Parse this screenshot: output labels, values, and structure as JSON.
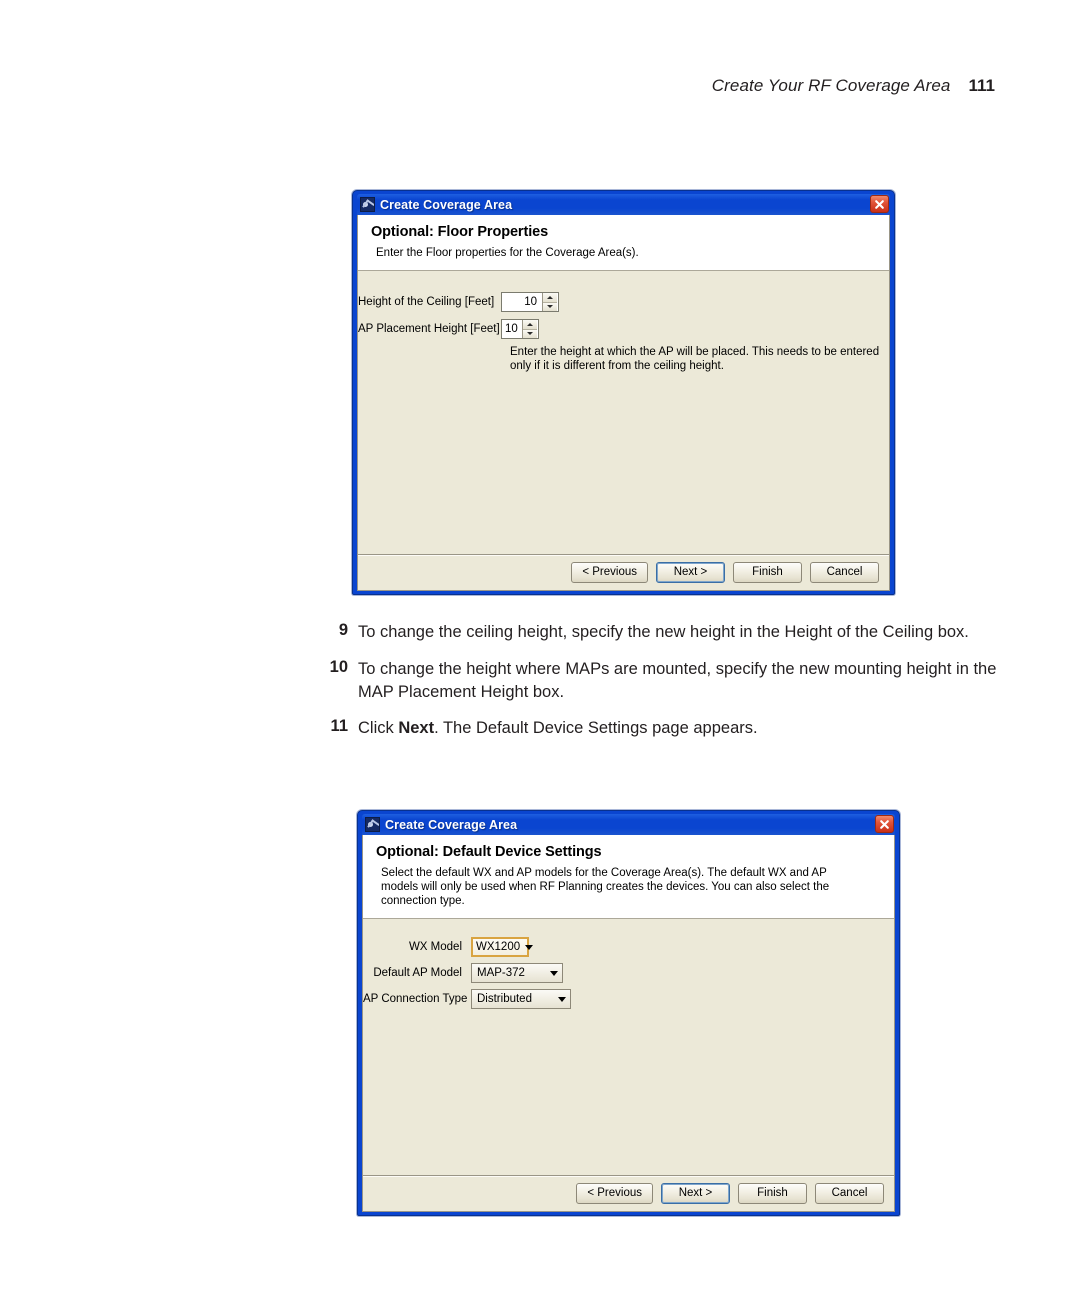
{
  "page": {
    "chapter_title": "Create Your RF Coverage Area",
    "page_number": "111"
  },
  "dialog1": {
    "title": "Create Coverage Area",
    "app_icon": "coverage-area-icon",
    "close_icon": "close-icon",
    "heading": "Optional: Floor Properties",
    "subtext": "Enter the Floor properties for the Coverage Area(s).",
    "fields": {
      "ceiling_height": {
        "label": "Height of the Ceiling [Feet]",
        "value": "10"
      },
      "ap_placement_height": {
        "label": "AP Placement Height [Feet]",
        "value": "10",
        "hint": "Enter the height at which the AP will be placed. This needs to be entered only if it is different from the ceiling height."
      }
    },
    "buttons": {
      "previous": "< Previous",
      "next": "Next >",
      "finish": "Finish",
      "cancel": "Cancel"
    }
  },
  "steps": [
    {
      "number": "9",
      "text": "To change the ceiling height, specify the new height in the Height of the Ceiling box."
    },
    {
      "number": "10",
      "text": "To change the height where MAPs are mounted, specify the new mounting height in the MAP Placement Height box."
    },
    {
      "number": "11",
      "text_before": "Click ",
      "bold": "Next",
      "text_after": ". The Default Device Settings page appears."
    }
  ],
  "dialog2": {
    "title": "Create Coverage Area",
    "app_icon": "coverage-area-icon",
    "close_icon": "close-icon",
    "heading": "Optional: Default Device Settings",
    "subtext": "Select the default WX and AP models for the Coverage Area(s). The default WX and AP models will only be used when RF Planning creates the devices. You can also select the connection type.",
    "fields": {
      "wx_model": {
        "label": "WX Model",
        "value": "WX1200"
      },
      "default_ap_model": {
        "label": "Default AP Model",
        "value": "MAP-372"
      },
      "ap_connection_type": {
        "label": "AP Connection Type",
        "value": "Distributed"
      }
    },
    "buttons": {
      "previous": "< Previous",
      "next": "Next >",
      "finish": "Finish",
      "cancel": "Cancel"
    }
  },
  "colors": {
    "titlebar_blue": "#0a45d0",
    "dialog_face": "#ece9d8",
    "close_red": "#c92f17",
    "focus_gold": "#d9a441"
  }
}
